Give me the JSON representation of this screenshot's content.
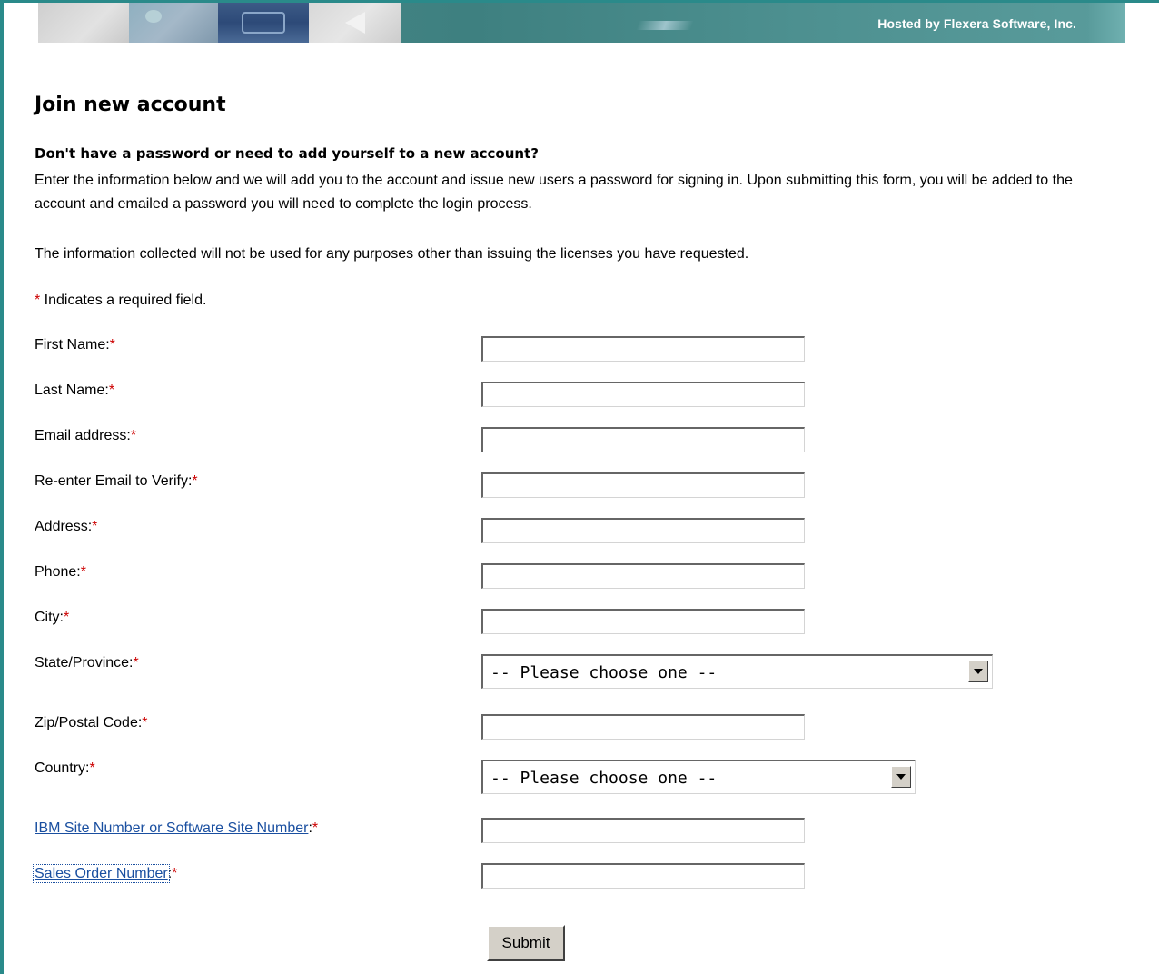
{
  "header": {
    "hosted_by": "Hosted by Flexera Software, Inc."
  },
  "page": {
    "title": "Join new account",
    "subhead": "Don't have a password or need to add yourself to a new account?",
    "intro": "Enter the information below and we will add you to the account and issue new users a password for signing in. Upon submitting this form, you will be added to the account and emailed a password you will need to complete the login process.",
    "privacy": "The information collected will not be used for any purposes other than issuing the licenses you have requested.",
    "required_marker": "*",
    "required_note": " Indicates a required field."
  },
  "form": {
    "fields": {
      "first_name": {
        "label": "First Name:",
        "value": ""
      },
      "last_name": {
        "label": "Last Name:",
        "value": ""
      },
      "email": {
        "label": "Email address:",
        "value": ""
      },
      "email_verify": {
        "label": "Re-enter Email to Verify:",
        "value": ""
      },
      "address": {
        "label": "Address:",
        "value": ""
      },
      "phone": {
        "label": "Phone:",
        "value": ""
      },
      "city": {
        "label": "City:",
        "value": ""
      },
      "state": {
        "label": "State/Province:",
        "selected": "-- Please choose one --"
      },
      "zip": {
        "label": "Zip/Postal Code:",
        "value": ""
      },
      "country": {
        "label": "Country:",
        "selected": "-- Please choose one --"
      },
      "site_number": {
        "label": "IBM Site Number or Software Site Number",
        "suffix": ":",
        "value": ""
      },
      "sales_order": {
        "label": "Sales Order Number",
        "suffix": ":",
        "value": ""
      }
    },
    "submit_label": "Submit"
  },
  "colors": {
    "frame": "#2a8a8a",
    "required": "#cc0000",
    "link": "#1a4fa0"
  }
}
